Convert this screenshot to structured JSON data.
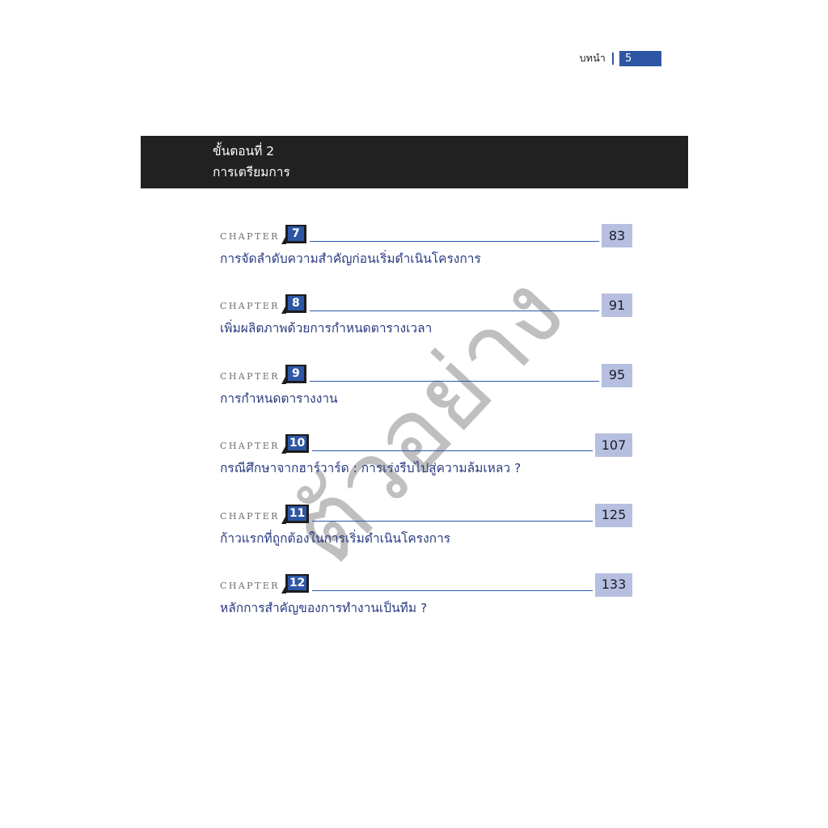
{
  "running_header": {
    "label": "บทนำ",
    "page": "5",
    "accent_color": "#2d56a5"
  },
  "watermark": {
    "text": "ตัวอย่าง",
    "color": "#b4b4b4",
    "rotation_deg": -47
  },
  "step_banner": {
    "line1": "ขั้นตอนที่ 2",
    "line2": "การเตรียมการ",
    "background_color": "#212121",
    "text_color": "#ffffff"
  },
  "toc": {
    "chapter_word": "CHAPTER",
    "entries": [
      {
        "chapter_label": "CHAPTER",
        "number": "7",
        "page": "83",
        "title": "การจัดลำดับความสำคัญก่อนเริ่มดำเนินโครงการ"
      },
      {
        "chapter_label": "CHAPTER",
        "number": "8",
        "page": "91",
        "title": "เพิ่มผลิตภาพด้วยการกำหนดตารางเวลา"
      },
      {
        "chapter_label": "CHAPTER",
        "number": "9",
        "page": "95",
        "title": "การกำหนดตารางงาน"
      },
      {
        "chapter_label": "CHAPTER",
        "number": "10",
        "page": "107",
        "title": "กรณีศึกษาจากฮาร์วาร์ด : การเร่งรีบไปสู่ความล้มเหลว ?"
      },
      {
        "chapter_label": "CHAPTER",
        "number": "11",
        "page": "125",
        "title": "ก้าวแรกที่ถูกต้องในการเริ่มดำเนินโครงการ"
      },
      {
        "chapter_label": "CHAPTER",
        "number": "12",
        "page": "133",
        "title": "หลักการสำคัญของการทำงานเป็นทีม ?"
      }
    ]
  },
  "colors": {
    "accent_blue": "#2d56a5",
    "page_box_blue": "#b6bfe0",
    "title_blue": "#2a3b80",
    "banner_black": "#212121",
    "chapter_gray": "#6e6e6e"
  }
}
